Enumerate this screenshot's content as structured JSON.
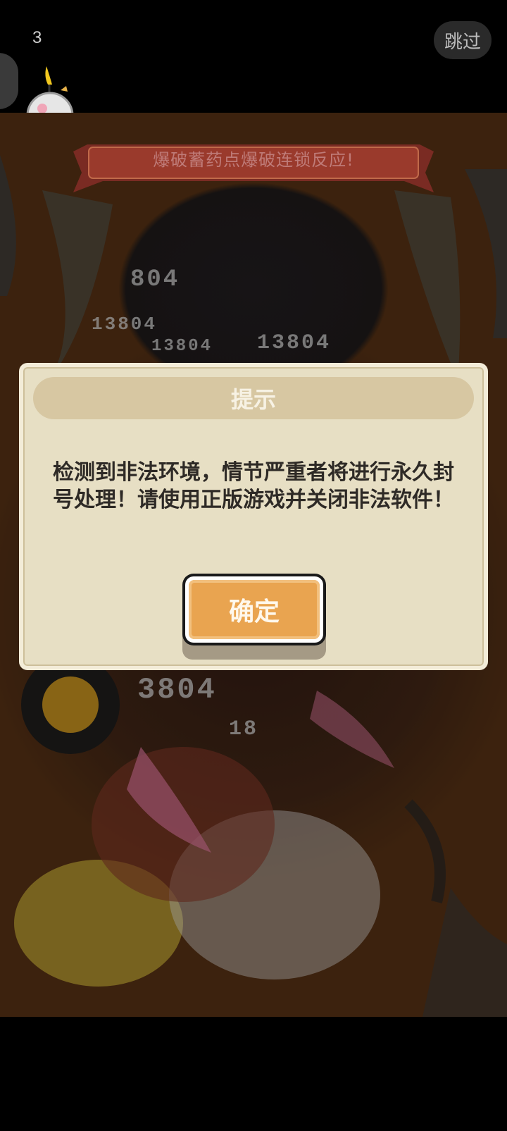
{
  "top_bar": {
    "countdown": "3",
    "skip_label": "跳过"
  },
  "scene": {
    "banner_text": "爆破蓄药点爆破连锁反应!",
    "damage_numbers": [
      "804",
      "13804",
      "13804",
      "13804",
      "3804",
      "18"
    ]
  },
  "dialog": {
    "title": "提示",
    "message": "检测到非法环境，情节严重者将进行永久封号处理！请使用正版游戏并关闭非法软件！",
    "confirm_label": "确定"
  },
  "icons": {
    "bomb": "bomb-icon",
    "side_tab": "side-tab"
  }
}
